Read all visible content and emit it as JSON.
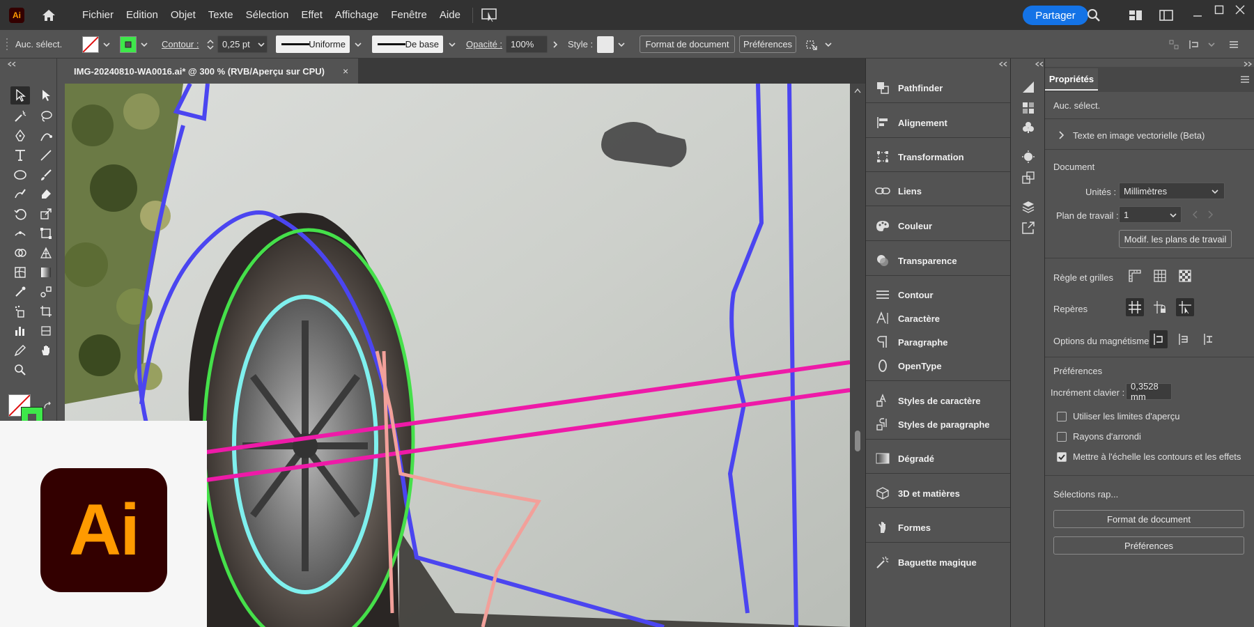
{
  "app": {
    "icon_label": "Ai",
    "logo_text": "Ai"
  },
  "menubar": {
    "items": [
      "Fichier",
      "Edition",
      "Objet",
      "Texte",
      "Sélection",
      "Effet",
      "Affichage",
      "Fenêtre",
      "Aide"
    ],
    "share_label": "Partager"
  },
  "controlbar": {
    "selection_label": "Auc. sélect.",
    "stroke_label": "Contour :",
    "stroke_weight": "0,25 pt",
    "stroke_profile": "Uniforme",
    "brush_label": "De base",
    "opacity_label": "Opacité :",
    "opacity_value": "100%",
    "style_label": "Style :",
    "doc_format_btn": "Format de document",
    "prefs_btn": "Préférences"
  },
  "document": {
    "tab_title": "IMG-20240810-WA0016.ai* @ 300 % (RVB/Aperçu sur CPU)",
    "close_glyph": "×"
  },
  "panels": [
    {
      "label": "Pathfinder",
      "icon": "pathfinder-icon"
    },
    {
      "label": "Alignement",
      "icon": "align-icon"
    },
    {
      "label": "Transformation",
      "icon": "transform-icon"
    },
    {
      "label": "Liens",
      "icon": "links-icon"
    },
    {
      "label": "Couleur",
      "icon": "color-icon"
    },
    {
      "label": "Transparence",
      "icon": "transparency-icon"
    },
    {
      "label": "Contour",
      "icon": "stroke-icon"
    },
    {
      "label": "Caractère",
      "icon": "character-icon"
    },
    {
      "label": "Paragraphe",
      "icon": "paragraph-icon"
    },
    {
      "label": "OpenType",
      "icon": "opentype-icon"
    },
    {
      "label": "Styles de caractère",
      "icon": "char-styles-icon"
    },
    {
      "label": "Styles de paragraphe",
      "icon": "para-styles-icon"
    },
    {
      "label": "Dégradé",
      "icon": "gradient-icon"
    },
    {
      "label": "3D et matières",
      "icon": "3d-icon"
    },
    {
      "label": "Formes",
      "icon": "shapes-icon"
    },
    {
      "label": "Baguette magique",
      "icon": "magic-wand-icon"
    }
  ],
  "properties": {
    "tab_label": "Propriétés",
    "no_selection": "Auc. sélect.",
    "text_to_vector": "Texte en image vectorielle (Beta)",
    "document_heading": "Document",
    "units_label": "Unités :",
    "units_value": "Millimètres",
    "artboard_label": "Plan de travail :",
    "artboard_value": "1",
    "edit_artboards_btn": "Modif. les plans de travail",
    "rulers_label": "Règle et grilles",
    "guides_label": "Repères",
    "snap_label": "Options du magnétisme",
    "prefs_heading": "Préférences",
    "keyboard_increment_label": "Incrément clavier :",
    "keyboard_increment_value": "0,3528 mm",
    "chk_preview_bounds": "Utiliser les limites d'aperçu",
    "chk_corner_radius": "Rayons d'arrondi",
    "chk_scale_strokes": "Mettre à l'échelle les contours et les effets",
    "quick_actions": "Sélections rap...",
    "doc_format_btn": "Format de document",
    "prefs_btn": "Préférences"
  }
}
